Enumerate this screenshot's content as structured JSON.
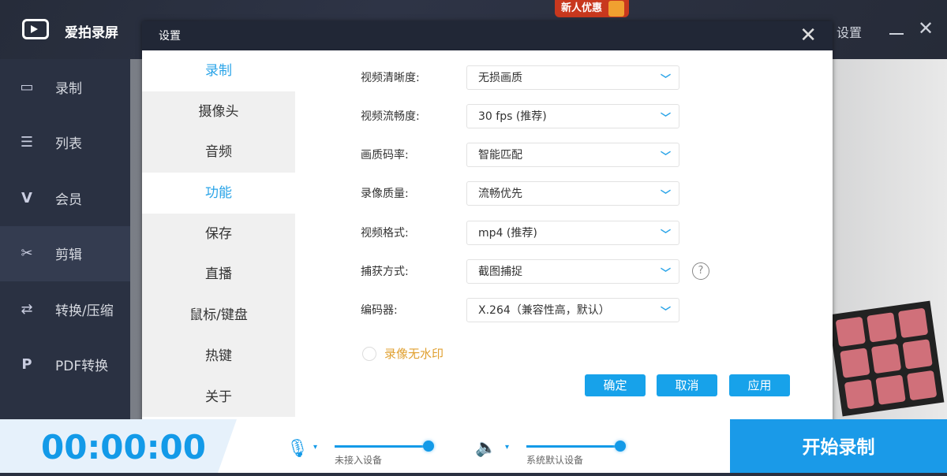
{
  "app": {
    "title": "爱拍录屏",
    "promo": "新人优惠",
    "settings_label": "设置"
  },
  "sidebar": {
    "items": [
      {
        "label": "录制",
        "icon": "camera-icon"
      },
      {
        "label": "列表",
        "icon": "list-icon"
      },
      {
        "label": "会员",
        "icon": "vip-icon"
      },
      {
        "label": "剪辑",
        "icon": "scissors-icon",
        "active": true
      },
      {
        "label": "转换/压缩",
        "icon": "convert-icon"
      },
      {
        "label": "PDF转换",
        "icon": "pdf-icon"
      }
    ]
  },
  "dialog": {
    "title": "设置",
    "nav": [
      {
        "label": "录制",
        "active": true
      },
      {
        "label": "摄像头"
      },
      {
        "label": "音频"
      },
      {
        "label": "功能",
        "active": true
      },
      {
        "label": "保存"
      },
      {
        "label": "直播"
      },
      {
        "label": "鼠标/键盘"
      },
      {
        "label": "热键"
      },
      {
        "label": "关于"
      }
    ],
    "fields": [
      {
        "label": "视频清晰度:",
        "value": "无损画质"
      },
      {
        "label": "视频流畅度:",
        "value": "30 fps (推荐)"
      },
      {
        "label": "画质码率:",
        "value": "智能匹配"
      },
      {
        "label": "录像质量:",
        "value": "流畅优先"
      },
      {
        "label": "视频格式:",
        "value": "mp4 (推荐)"
      },
      {
        "label": "捕获方式:",
        "value": "截图捕捉"
      },
      {
        "label": "编码器:",
        "value": "X.264（兼容性高，默认）"
      }
    ],
    "help_glyph": "?",
    "watermark_label": "录像无水印",
    "watermark_checked": false,
    "buttons": {
      "ok": "确定",
      "cancel": "取消",
      "apply": "应用"
    }
  },
  "bottom": {
    "timer": "00:00:00",
    "mic_device": "未接入设备",
    "mic_level": 100,
    "speaker_device": "系统默认设备",
    "speaker_level": 100,
    "start_label": "开始录制"
  },
  "colors": {
    "accent": "#17a2ea",
    "promo": "#c8381e",
    "watermark": "#e0a030"
  }
}
